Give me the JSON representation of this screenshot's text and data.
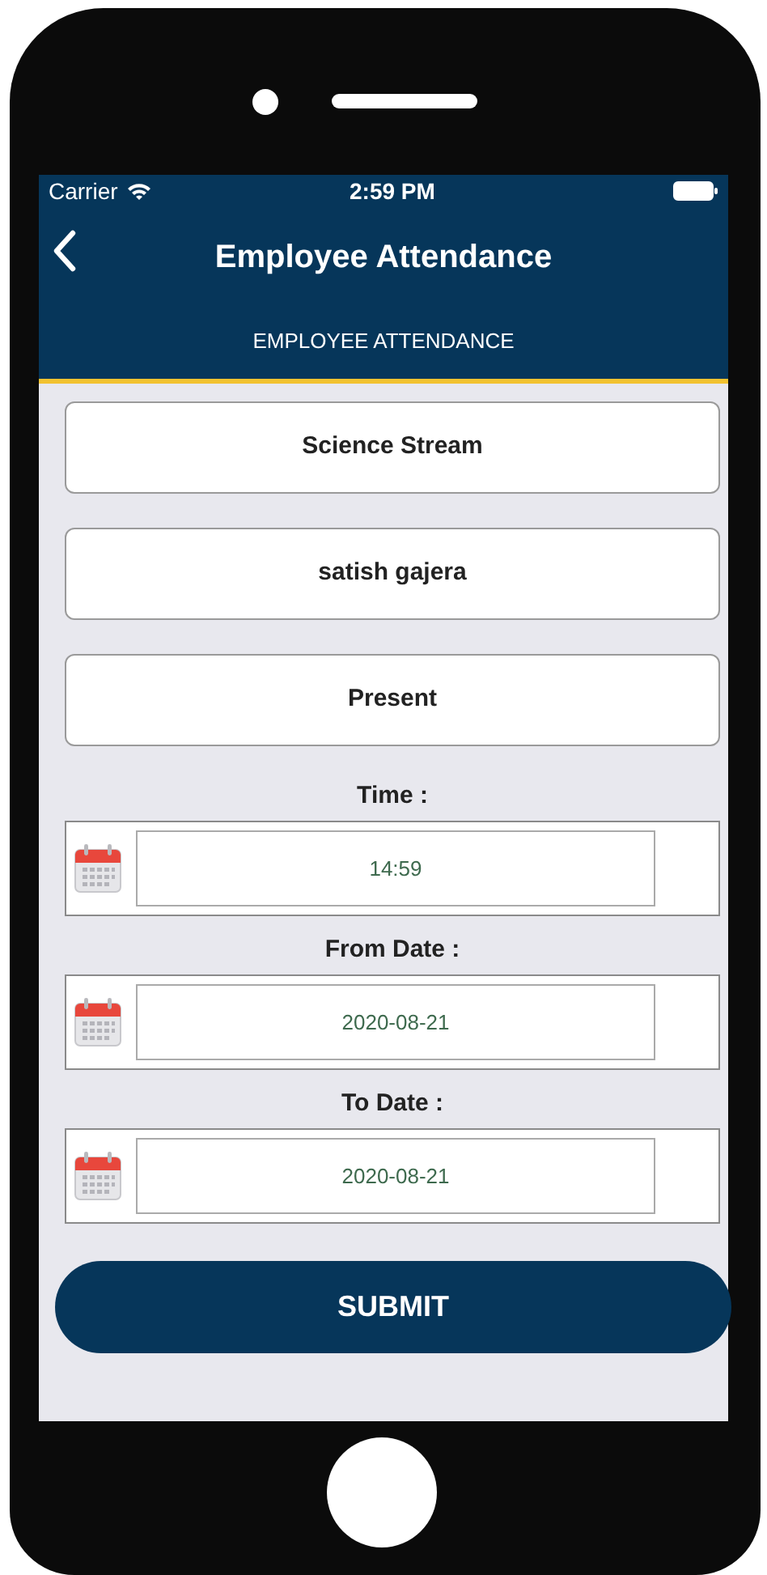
{
  "status_bar": {
    "carrier": "Carrier",
    "time": "2:59 PM"
  },
  "nav_bar": {
    "title": "Employee Attendance"
  },
  "section_header": "EMPLOYEE ATTENDANCE",
  "selects": [
    {
      "value": "Science Stream"
    },
    {
      "value": "satish gajera"
    },
    {
      "value": "Present"
    }
  ],
  "picker_fields": [
    {
      "label": "Time :",
      "value": "14:59"
    },
    {
      "label": "From Date :",
      "value": "2020-08-21"
    },
    {
      "label": "To Date :",
      "value": "2020-08-21"
    }
  ],
  "submit_button": "SUBMIT"
}
